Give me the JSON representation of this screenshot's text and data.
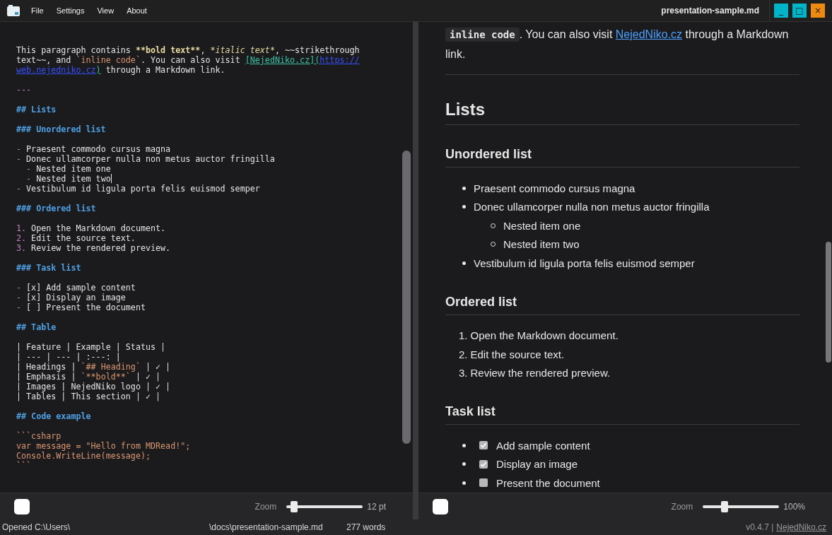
{
  "titlebar": {
    "menu": [
      "File",
      "Settings",
      "View",
      "About"
    ],
    "title": "presentation-sample.md",
    "buttons": [
      {
        "kind": "minimize",
        "glyph": "_"
      },
      {
        "kind": "maximize",
        "glyph": "□"
      },
      {
        "kind": "close",
        "glyph": "×"
      }
    ]
  },
  "editor": {
    "lines": [
      {
        "kind": "text",
        "segments": [
          {
            "kind": "plain",
            "text": "This paragraph contains "
          },
          {
            "kind": "bold",
            "text": "**bold text**"
          },
          {
            "kind": "plain",
            "text": ", "
          },
          {
            "kind": "italic",
            "text": "*italic text*"
          },
          {
            "kind": "plain",
            "text": ", ~~strikethrough"
          }
        ]
      },
      {
        "kind": "text",
        "segments": [
          {
            "kind": "plain",
            "text": "text~~, and "
          },
          {
            "kind": "code",
            "text": "`inline code`"
          },
          {
            "kind": "plain",
            "text": ". You can also visit "
          },
          {
            "kind": "link",
            "text": "[NejedNiko.cz]("
          },
          {
            "kind": "url",
            "text": "https://"
          }
        ]
      },
      {
        "kind": "text",
        "segments": [
          {
            "kind": "url",
            "text": "web.nejedniko.cz"
          },
          {
            "kind": "link",
            "text": ")"
          },
          {
            "kind": "plain",
            "text": " through a Markdown link."
          }
        ]
      },
      {
        "kind": "blank"
      },
      {
        "kind": "text",
        "segments": [
          {
            "kind": "marker",
            "text": "---"
          }
        ]
      },
      {
        "kind": "blank"
      },
      {
        "kind": "text",
        "segments": [
          {
            "kind": "heading",
            "text": "## Lists"
          }
        ]
      },
      {
        "kind": "blank"
      },
      {
        "kind": "text",
        "segments": [
          {
            "kind": "heading",
            "text": "### Unordered list"
          }
        ]
      },
      {
        "kind": "blank"
      },
      {
        "kind": "text",
        "segments": [
          {
            "kind": "marker",
            "text": "-"
          },
          {
            "kind": "plain",
            "text": " Praesent commodo cursus magna"
          }
        ]
      },
      {
        "kind": "text",
        "segments": [
          {
            "kind": "marker",
            "text": "-"
          },
          {
            "kind": "plain",
            "text": " Donec ullamcorper nulla non metus auctor fringilla"
          }
        ]
      },
      {
        "kind": "text",
        "segments": [
          {
            "kind": "marker",
            "text": "  -"
          },
          {
            "kind": "plain",
            "text": " Nested item one"
          }
        ]
      },
      {
        "kind": "text",
        "cursor": true,
        "segments": [
          {
            "kind": "marker",
            "text": "  -"
          },
          {
            "kind": "plain",
            "text": " Nested item two"
          }
        ]
      },
      {
        "kind": "text",
        "segments": [
          {
            "kind": "marker",
            "text": "-"
          },
          {
            "kind": "plain",
            "text": " Vestibulum id ligula porta felis euismod semper"
          }
        ]
      },
      {
        "kind": "blank"
      },
      {
        "kind": "text",
        "segments": [
          {
            "kind": "heading",
            "text": "### Ordered list"
          }
        ]
      },
      {
        "kind": "blank"
      },
      {
        "kind": "text",
        "segments": [
          {
            "kind": "marker",
            "text": "1."
          },
          {
            "kind": "plain",
            "text": " Open the Markdown document."
          }
        ]
      },
      {
        "kind": "text",
        "segments": [
          {
            "kind": "marker",
            "text": "2."
          },
          {
            "kind": "plain",
            "text": " Edit the source text."
          }
        ]
      },
      {
        "kind": "text",
        "segments": [
          {
            "kind": "marker",
            "text": "3."
          },
          {
            "kind": "plain",
            "text": " Review the rendered preview."
          }
        ]
      },
      {
        "kind": "blank"
      },
      {
        "kind": "text",
        "segments": [
          {
            "kind": "heading",
            "text": "### Task list"
          }
        ]
      },
      {
        "kind": "blank"
      },
      {
        "kind": "text",
        "segments": [
          {
            "kind": "marker",
            "text": "-"
          },
          {
            "kind": "plain",
            "text": " [x] Add sample content"
          }
        ]
      },
      {
        "kind": "text",
        "segments": [
          {
            "kind": "marker",
            "text": "-"
          },
          {
            "kind": "plain",
            "text": " [x] Display an image"
          }
        ]
      },
      {
        "kind": "text",
        "segments": [
          {
            "kind": "marker",
            "text": "-"
          },
          {
            "kind": "plain",
            "text": " [ ] Present the document"
          }
        ]
      },
      {
        "kind": "blank"
      },
      {
        "kind": "text",
        "segments": [
          {
            "kind": "heading",
            "text": "## Table"
          }
        ]
      },
      {
        "kind": "blank"
      },
      {
        "kind": "text",
        "segments": [
          {
            "kind": "plain",
            "text": "| Feature | Example | Status |"
          }
        ]
      },
      {
        "kind": "text",
        "segments": [
          {
            "kind": "plain",
            "text": "| --- | --- | :---: |"
          }
        ]
      },
      {
        "kind": "text",
        "segments": [
          {
            "kind": "plain",
            "text": "| Headings | "
          },
          {
            "kind": "code",
            "text": "`## Heading`"
          },
          {
            "kind": "plain",
            "text": " | ✓ |"
          }
        ]
      },
      {
        "kind": "text",
        "segments": [
          {
            "kind": "plain",
            "text": "| Emphasis | "
          },
          {
            "kind": "code",
            "text": "`**bold**`"
          },
          {
            "kind": "plain",
            "text": " | ✓ |"
          }
        ]
      },
      {
        "kind": "text",
        "segments": [
          {
            "kind": "plain",
            "text": "| Images | NejedNiko logo | ✓ |"
          }
        ]
      },
      {
        "kind": "text",
        "segments": [
          {
            "kind": "plain",
            "text": "| Tables | This section | ✓ |"
          }
        ]
      },
      {
        "kind": "blank"
      },
      {
        "kind": "text",
        "segments": [
          {
            "kind": "heading",
            "text": "## Code example"
          }
        ]
      },
      {
        "kind": "blank"
      },
      {
        "kind": "text",
        "segments": [
          {
            "kind": "code",
            "text": "```csharp"
          }
        ]
      },
      {
        "kind": "text",
        "segments": [
          {
            "kind": "code",
            "text": "var message = \"Hello from MDRead!\";"
          }
        ]
      },
      {
        "kind": "text",
        "segments": [
          {
            "kind": "code",
            "text": "Console.WriteLine(message);"
          }
        ]
      },
      {
        "kind": "text",
        "segments": [
          {
            "kind": "code",
            "text": "```"
          }
        ]
      }
    ],
    "toolbar": {
      "zoom_label": "Zoom",
      "level": 0.08,
      "reading": "12 pt"
    }
  },
  "preview": {
    "blocks": [
      {
        "kind": "paragraph",
        "segments": [
          {
            "kind": "code",
            "text": "inline code"
          },
          {
            "kind": "text",
            "text": ". You can also visit "
          },
          {
            "kind": "link",
            "text": "NejedNiko.cz"
          },
          {
            "kind": "text",
            "text": " through a Markdown link."
          }
        ]
      },
      {
        "kind": "rule"
      },
      {
        "kind": "h2",
        "text": "Lists"
      },
      {
        "kind": "h3",
        "text": "Unordered list"
      },
      {
        "kind": "ul",
        "items": [
          {
            "text": "Praesent commodo cursus magna"
          },
          {
            "text": "Donec ullamcorper nulla non metus auctor fringilla",
            "children": [
              {
                "text": "Nested item one"
              },
              {
                "text": "Nested item two"
              }
            ]
          },
          {
            "text": "Vestibulum id ligula porta felis euismod semper"
          }
        ]
      },
      {
        "kind": "h3",
        "text": "Ordered list"
      },
      {
        "kind": "ol",
        "items": [
          {
            "number": "1.",
            "text": "Open the Markdown document."
          },
          {
            "number": "2.",
            "text": "Edit the source text."
          },
          {
            "number": "3.",
            "text": "Review the rendered preview."
          }
        ]
      },
      {
        "kind": "h3",
        "text": "Task list"
      },
      {
        "kind": "tasks",
        "items": [
          {
            "text": "Add sample content",
            "checked": true
          },
          {
            "text": "Display an image",
            "checked": true
          },
          {
            "text": "Present the document",
            "checked": false
          }
        ]
      }
    ],
    "toolbar": {
      "zoom_label": "Zoom",
      "level": 0.27,
      "reading": "100%"
    }
  },
  "status_bar": {
    "opened": "Opened C:\\Users\\",
    "path": "\\docs\\presentation-sample.md",
    "words": "277 words",
    "version": "v0.4.7 |",
    "link": "NejedNiko.cz"
  }
}
